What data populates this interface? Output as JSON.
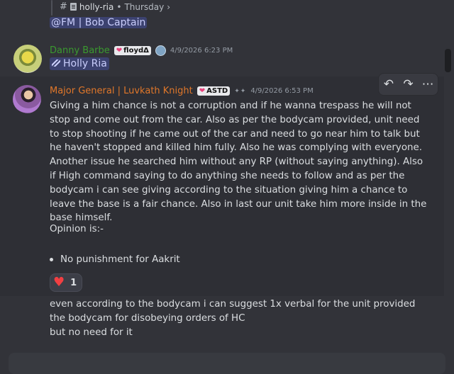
{
  "thread_ref": {
    "hash": "#",
    "channel": "holly-ria",
    "sep": "•",
    "day": "Thursday",
    "chevron": "›"
  },
  "mention_fm": "@FM | Bob Captain",
  "message1": {
    "author": "Danny Barbe",
    "author_color": "#3a9a2f",
    "tag_label": "floydΔ",
    "timestamp": "4/9/2026 6:23 PM",
    "mention": "Holly Ria"
  },
  "message2": {
    "author": "Major General | Luvkath  Knight",
    "author_color": "#e0772a",
    "tag_label": "ASTD",
    "stars": "✦✦",
    "timestamp": "4/9/2026 6:53 PM",
    "body": "Giving a him chance is not a corruption and if he wanna trespass he will not stop and come out from the car. Also as per the bodycam provided, unit need to stop shooting if he came out of the car and need to go near him to talk but he haven't stopped and killed him fully. Also he was complying with everyone. Another issue he searched him without any RP (without saying anything). Also if High command saying to do anything she needs to follow and as per the bodycam i can see giving according to the situation giving him a chance to leave the base is a fair chance. Also in last our unit take him more inside in the base himself.",
    "opinion": "Opinion is:-",
    "bullet": "No punishment for Aakrit",
    "reaction": {
      "emoji": "heart",
      "count": "1"
    }
  },
  "followups": [
    "even according to the bodycam i can suggest 1x verbal for the unit provided the bodycam for disobeying orders of HC",
    "but no need for it"
  ],
  "toolbar": {
    "icons": [
      "reply-icon",
      "forward-icon",
      "more-icon"
    ]
  }
}
